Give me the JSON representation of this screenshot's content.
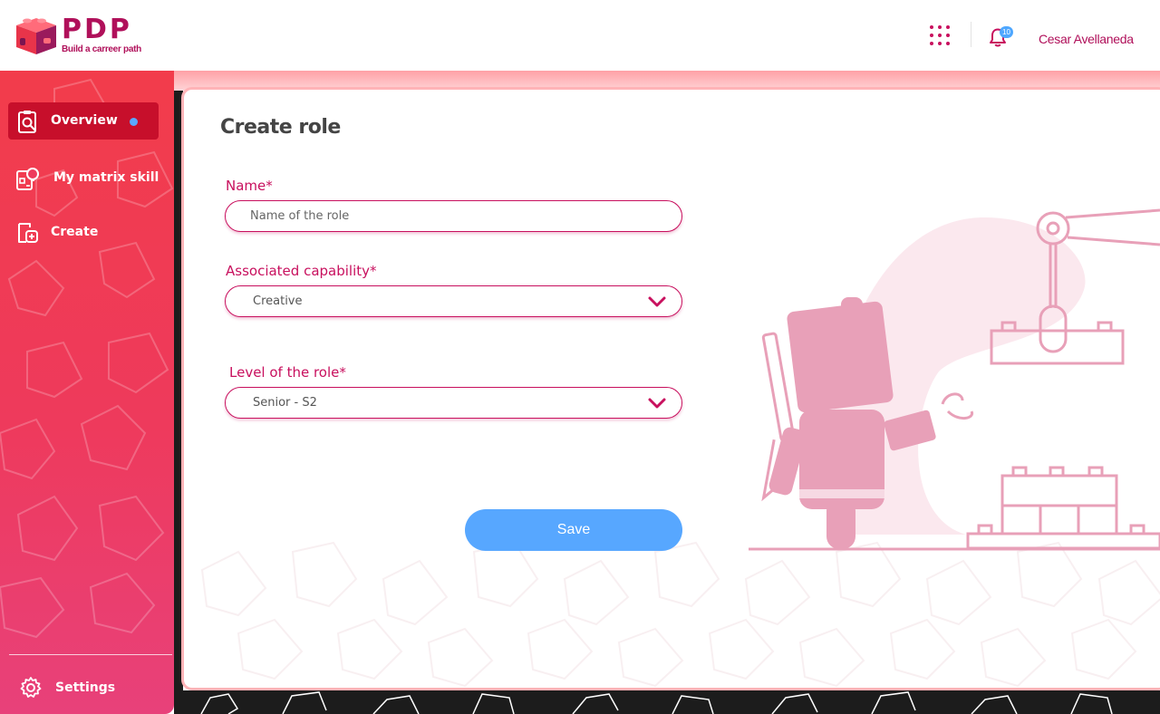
{
  "header": {
    "logo_text": "PDP",
    "logo_tagline": "Build a carreer path",
    "apps_icon": "grid-dots-icon",
    "notifications_icon": "bell-icon",
    "notification_count": "10",
    "user_name": "Cesar Avellaneda"
  },
  "sidebar": {
    "items": [
      {
        "label": "Overview",
        "icon": "clipboard-search-icon",
        "active": true
      },
      {
        "label": "My matrix skill",
        "icon": "lightbulb-matrix-icon",
        "active": false
      },
      {
        "label": "Create",
        "icon": "document-plus-icon",
        "active": false
      }
    ],
    "settings_label": "Settings",
    "settings_icon": "gear-icon"
  },
  "form": {
    "title": "Create role",
    "name_label": "Name*",
    "name_placeholder": "Name of the role",
    "name_value": "",
    "capability_label": "Associated capability*",
    "capability_value": "Creative",
    "level_label": "Level of the role*",
    "level_value": "Senior - S2",
    "save_label": "Save"
  },
  "colors": {
    "brand": "#b0105a",
    "accent_pink": "#c8105e",
    "sidebar_top": "#f23c4b",
    "sidebar_bottom": "#e8417a",
    "active_item": "#c70f2b",
    "primary_button": "#57a7ff",
    "illustration": "#e8a0b8"
  }
}
